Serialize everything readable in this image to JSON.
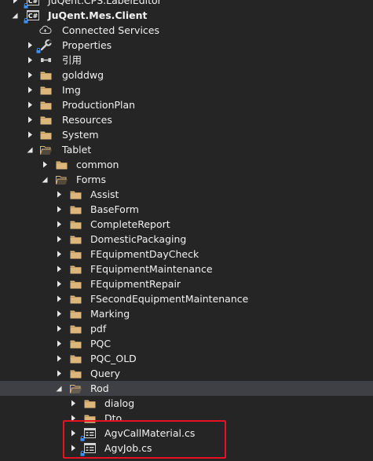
{
  "tree": {
    "items": [
      {
        "label": "JuQent.CPS.LabelEditor",
        "level": 0,
        "arrow": "collapsed",
        "icon": "csharp-project-icon",
        "bold": false
      },
      {
        "label": "JuQent.Mes.Client",
        "level": 0,
        "arrow": "expanded",
        "icon": "csharp-project-icon",
        "bold": true
      },
      {
        "label": "Connected Services",
        "level": 1,
        "arrow": "none",
        "icon": "connected-services-icon"
      },
      {
        "label": "Properties",
        "level": 1,
        "arrow": "collapsed",
        "icon": "wrench-icon"
      },
      {
        "label": "引用",
        "level": 1,
        "arrow": "collapsed",
        "icon": "references-icon"
      },
      {
        "label": "golddwg",
        "level": 1,
        "arrow": "collapsed",
        "icon": "folder-icon"
      },
      {
        "label": "Img",
        "level": 1,
        "arrow": "collapsed",
        "icon": "folder-icon"
      },
      {
        "label": "ProductionPlan",
        "level": 1,
        "arrow": "collapsed",
        "icon": "folder-icon"
      },
      {
        "label": "Resources",
        "level": 1,
        "arrow": "collapsed",
        "icon": "folder-icon"
      },
      {
        "label": "System",
        "level": 1,
        "arrow": "collapsed",
        "icon": "folder-icon"
      },
      {
        "label": "Tablet",
        "level": 1,
        "arrow": "expanded",
        "icon": "folder-open-icon"
      },
      {
        "label": "common",
        "level": 2,
        "arrow": "collapsed",
        "icon": "folder-icon"
      },
      {
        "label": "Forms",
        "level": 2,
        "arrow": "expanded",
        "icon": "folder-open-icon"
      },
      {
        "label": "Assist",
        "level": 3,
        "arrow": "collapsed",
        "icon": "folder-icon"
      },
      {
        "label": "BaseForm",
        "level": 3,
        "arrow": "collapsed",
        "icon": "folder-icon"
      },
      {
        "label": "CompleteReport",
        "level": 3,
        "arrow": "collapsed",
        "icon": "folder-icon"
      },
      {
        "label": "DomesticPackaging",
        "level": 3,
        "arrow": "collapsed",
        "icon": "folder-icon"
      },
      {
        "label": "FEquipmentDayCheck",
        "level": 3,
        "arrow": "collapsed",
        "icon": "folder-icon"
      },
      {
        "label": "FEquipmentMaintenance",
        "level": 3,
        "arrow": "collapsed",
        "icon": "folder-icon"
      },
      {
        "label": "FEquipmentRepair",
        "level": 3,
        "arrow": "collapsed",
        "icon": "folder-icon"
      },
      {
        "label": "FSecondEquipmentMaintenance",
        "level": 3,
        "arrow": "collapsed",
        "icon": "folder-icon"
      },
      {
        "label": "Marking",
        "level": 3,
        "arrow": "collapsed",
        "icon": "folder-icon"
      },
      {
        "label": "pdf",
        "level": 3,
        "arrow": "collapsed",
        "icon": "folder-icon"
      },
      {
        "label": "PQC",
        "level": 3,
        "arrow": "collapsed",
        "icon": "folder-icon"
      },
      {
        "label": "PQC_OLD",
        "level": 3,
        "arrow": "collapsed",
        "icon": "folder-icon"
      },
      {
        "label": "Query",
        "level": 3,
        "arrow": "collapsed",
        "icon": "folder-icon"
      },
      {
        "label": "Rod",
        "level": 3,
        "arrow": "expanded",
        "icon": "folder-open-icon",
        "selected": true
      },
      {
        "label": "dialog",
        "level": 4,
        "arrow": "collapsed",
        "icon": "folder-icon"
      },
      {
        "label": "Dto",
        "level": 4,
        "arrow": "collapsed",
        "icon": "folder-icon"
      },
      {
        "label": "AgvCallMaterial.cs",
        "level": 4,
        "arrow": "collapsed",
        "icon": "form-file-icon"
      },
      {
        "label": "AgvJob.cs",
        "level": 4,
        "arrow": "collapsed",
        "icon": "form-file-icon"
      }
    ]
  },
  "colors": {
    "background": "#252526",
    "selected_row": "#3f3f46",
    "text": "#f1f1f1",
    "folder": "#dcb67a",
    "highlight_border": "#e81123",
    "lock": "#3794ff"
  }
}
